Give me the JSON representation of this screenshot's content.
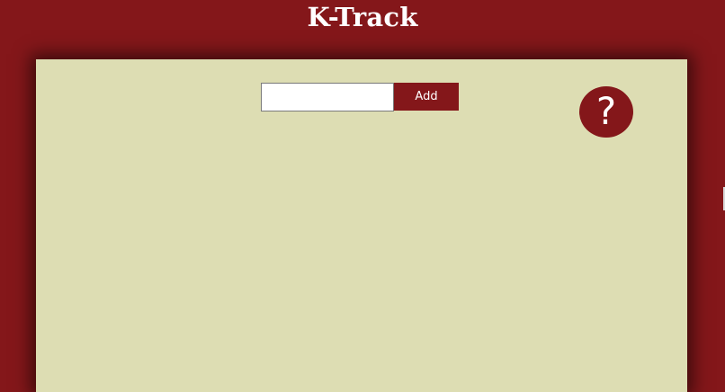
{
  "app": {
    "title": "K-Track"
  },
  "add_form": {
    "input_value": "",
    "input_placeholder": "",
    "button_label": "Add"
  },
  "help": {
    "icon": "help-icon",
    "glyph": "?"
  },
  "colors": {
    "brand": "#84171a",
    "panel": "#ddddb3",
    "text_on_brand": "#ffffff"
  }
}
